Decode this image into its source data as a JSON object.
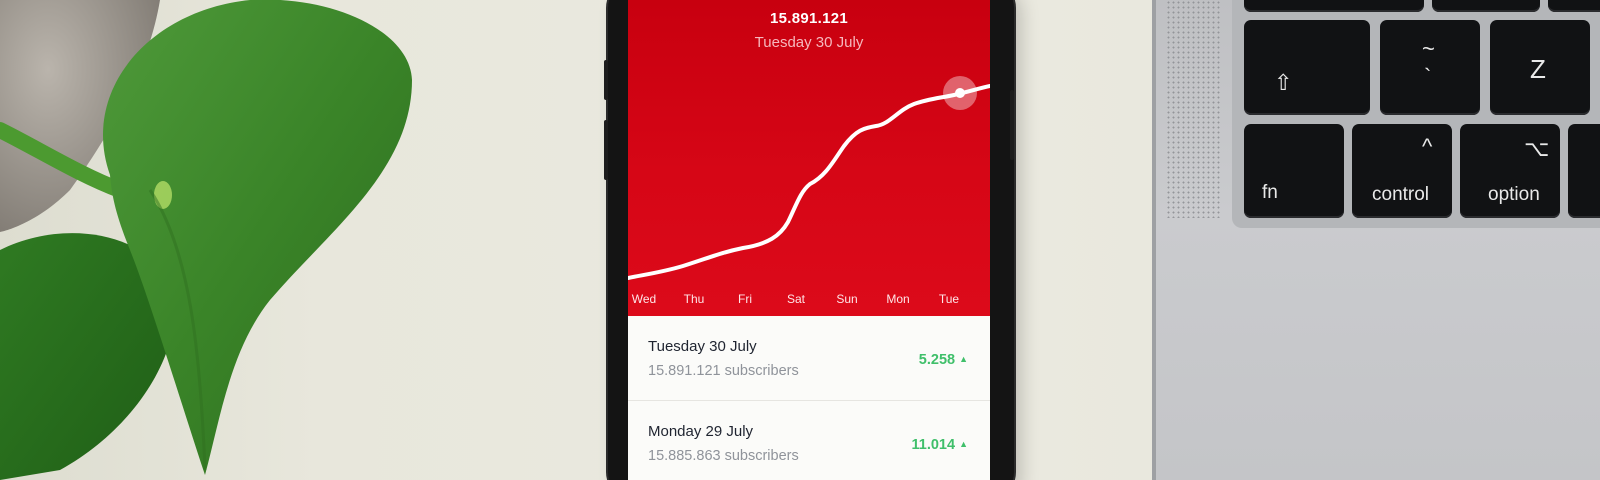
{
  "phone": {
    "headline_value": "15.891.121",
    "headline_date": "Tuesday 30 July",
    "days": [
      "Wed",
      "Thu",
      "Fri",
      "Sat",
      "Sun",
      "Mon",
      "Tue"
    ],
    "rows": [
      {
        "title": "Tuesday 30 July",
        "subtitle": "15.891.121 subscribers",
        "change": "5.258",
        "trend": "▲"
      },
      {
        "title": "Monday 29 July",
        "subtitle": "15.885.863 subscribers",
        "change": "11.014",
        "trend": "▲"
      }
    ],
    "colors": {
      "accent": "#d60616",
      "positive": "#3fbf6a"
    }
  },
  "laptop_keys": {
    "shift_glyph": "⇧",
    "tilde_glyph": "~",
    "backtick_glyph": "`",
    "z_label": "Z",
    "fn_label": "fn",
    "control_glyph": "^",
    "control_label": "control",
    "option_glyph": "⌥",
    "option_label": "option"
  }
}
